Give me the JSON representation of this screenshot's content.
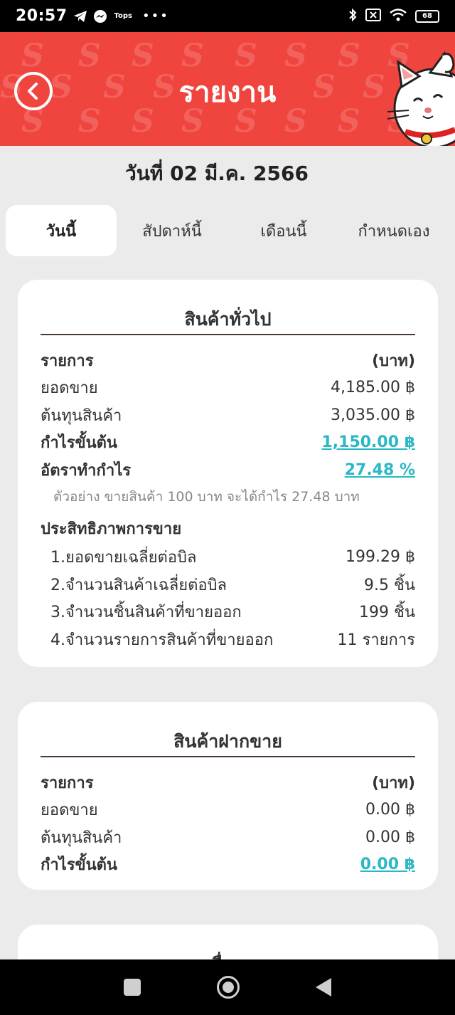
{
  "status_bar": {
    "time": "20:57",
    "small_label": "Tops",
    "dots": "•••",
    "battery": "68"
  },
  "header": {
    "title": "รายงาน"
  },
  "date": "วันที่ 02  มี.ค. 2566",
  "tabs": [
    {
      "label": "วันนี้",
      "active": true
    },
    {
      "label": "สัปดาห์นี้",
      "active": false
    },
    {
      "label": "เดือนนี้",
      "active": false
    },
    {
      "label": "กำหนดเอง",
      "active": false
    }
  ],
  "general": {
    "title": "สินค้าทั่วไป",
    "header_left": "รายการ",
    "header_right": "(บาท)",
    "sales_label": "ยอดขาย",
    "sales_value": "4,185.00 ฿",
    "cost_label": "ต้นทุนสินค้า",
    "cost_value": "3,035.00 ฿",
    "gross_profit_label": "กำไรขั้นต้น",
    "gross_profit_value": "1,150.00 ฿",
    "margin_label": "อัตราทำกำไร",
    "margin_value": "27.48 %",
    "example_note": "ตัวอย่าง  ขายสินค้า 100 บาท จะได้กำไร 27.48 บาท",
    "efficiency_title": "ประสิทธิภาพการขาย",
    "efficiency": [
      {
        "label": "1.ยอดขายเฉลี่ยต่อบิล",
        "value": "199.29 ฿"
      },
      {
        "label": "2.จำนวนสินค้าเฉลี่ยต่อบิล",
        "value": "9.5 ชิ้น"
      },
      {
        "label": "3.จำนวนชิ้นสินค้าที่ขายออก",
        "value": "199 ชิ้น"
      },
      {
        "label": "4.จำนวนรายการสินค้าที่ขายออก",
        "value": "11 รายการ"
      }
    ]
  },
  "consignment": {
    "title": "สินค้าฝากขาย",
    "header_left": "รายการ",
    "header_right": "(บาท)",
    "sales_label": "ยอดขาย",
    "sales_value": "0.00 ฿",
    "cost_label": "ต้นทุนสินค้า",
    "cost_value": "0.00 ฿",
    "gross_profit_label": "กำไรขั้นต้น",
    "gross_profit_value": "0.00 ฿"
  },
  "other": {
    "title": "อื่นๆ"
  },
  "colors": {
    "header_red": "#f0453f",
    "link_teal": "#29b8c4",
    "background": "#ebebeb"
  }
}
